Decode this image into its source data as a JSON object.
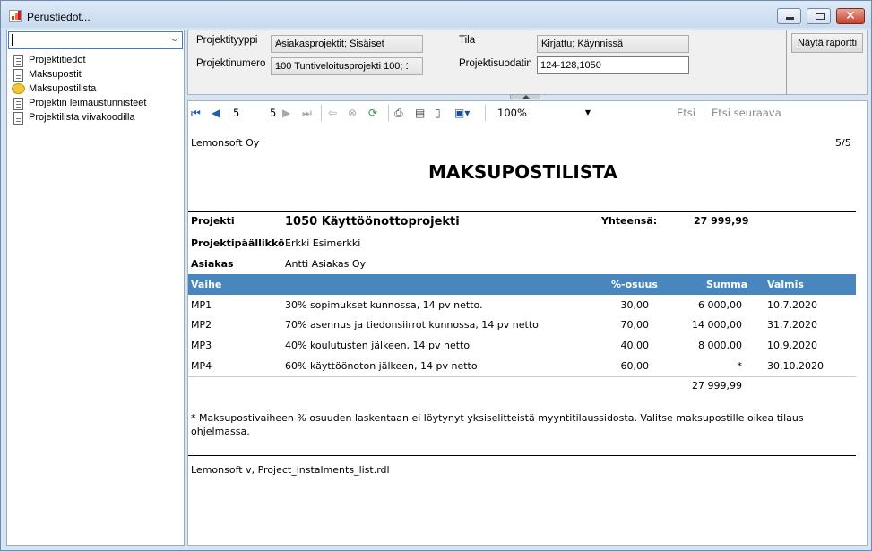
{
  "window": {
    "title": "Perustiedot...",
    "minimize": "▁",
    "maximize": "□",
    "close": "✕"
  },
  "left": {
    "combo_value": "",
    "items": [
      {
        "label": "Projektitiedot",
        "icon": "document-icon"
      },
      {
        "label": "Maksupostit",
        "icon": "document-icon"
      },
      {
        "label": "Maksupostilista",
        "icon": "speech-bubble-icon"
      },
      {
        "label": "Projektin leimaustunnisteet",
        "icon": "document-icon"
      },
      {
        "label": "Projektilista viivakoodilla",
        "icon": "document-icon"
      }
    ]
  },
  "params": {
    "tyyppi_label": "Projektityyppi",
    "tyyppi_value": "Asiakasprojektit; Sisäiset",
    "numero_label": "Projektinumero",
    "numero_value": "100 Tuntiveloitusprojekti 100; 1",
    "tila_label": "Tila",
    "tila_value": "Kirjattu; Käynnissä",
    "suodatin_label": "Projektisuodatin",
    "suodatin_value": "124-128,1050",
    "show_report": "Näytä raportti"
  },
  "toolbar": {
    "current_page": "5",
    "total_pages": "5",
    "zoom": "100%",
    "find": "Etsi",
    "find_next": "Etsi seuraava"
  },
  "report": {
    "company": "Lemonsoft Oy",
    "page_indicator": "5/5",
    "title": "MAKSUPOSTILISTA",
    "projekti_label": "Projekti",
    "projekti_value": "1050 Käyttöönottoprojekti",
    "yhteensa_label": "Yhteensä:",
    "yhteensa_value": "27 999,99",
    "pm_label": "Projektipäällikkö",
    "pm_value": "Erkki Esimerkki",
    "asiakas_label": "Asiakas",
    "asiakas_value": "Antti Asiakas Oy",
    "columns": {
      "vaihe": "Vaihe",
      "osuus": "%-osuus",
      "summa": "Summa",
      "valmis": "Valmis"
    },
    "rows": [
      {
        "vaihe": "MP1",
        "desc": "30% sopimukset kunnossa, 14 pv netto.",
        "osuus": "30,00",
        "summa": "6 000,00",
        "valmis": "10.7.2020"
      },
      {
        "vaihe": "MP2",
        "desc": "70% asennus ja tiedonsiirrot kunnossa, 14 pv netto",
        "osuus": "70,00",
        "summa": "14 000,00",
        "valmis": "31.7.2020"
      },
      {
        "vaihe": "MP3",
        "desc": "40% koulutusten jälkeen, 14  pv netto",
        "osuus": "40,00",
        "summa": "8 000,00",
        "valmis": "10.9.2020"
      },
      {
        "vaihe": "MP4",
        "desc": "60% käyttöönoton jälkeen, 14 pv netto",
        "osuus": "60,00",
        "summa": "*",
        "valmis": "30.10.2020"
      }
    ],
    "total": "27 999,99",
    "note_line1": "* Maksupostivaiheen % osuuden laskentaan ei löytynyt yksiselitteistä myyntitilaussidosta. Valitse maksupostille oikea tilaus",
    "note_line2": "ohjelmassa.",
    "footer": "Lemonsoft v, Project_instalments_list.rdl"
  }
}
